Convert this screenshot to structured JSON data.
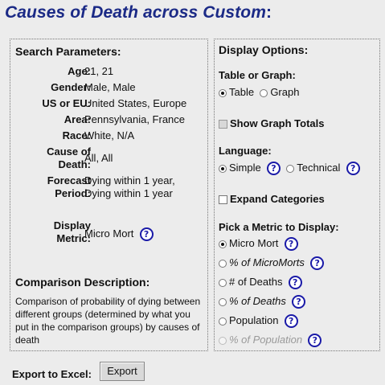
{
  "title": {
    "colored": "Causes of Death across ",
    "custom": "Custom",
    "colon": ":"
  },
  "search": {
    "heading": "Search Parameters:",
    "params": [
      {
        "label": "Age:",
        "value": "21, 21"
      },
      {
        "label": "Gender:",
        "value": "Male, Male"
      },
      {
        "label": "US or EU:",
        "value": "United States, Europe"
      },
      {
        "label": "Area:",
        "value": "Pennsylvania, France"
      },
      {
        "label": "Race:",
        "value": "White, N/A"
      },
      {
        "label_line1": "Cause of",
        "label_line2": "Death:",
        "value": "All, All"
      },
      {
        "label_line1": "Forecast",
        "label_line2": "Period:",
        "value_line1": "Dying within 1 year,",
        "value_line2": "Dying within 1 year"
      },
      {
        "label_line1": "Display",
        "label_line2": "Metric:",
        "value": "Micro Mort"
      }
    ],
    "comparison_heading": "Comparison Description:",
    "comparison_text": "Comparison of probability of dying between different groups (determined by what you put in the comparison groups) by causes of death"
  },
  "display": {
    "heading": "Display Options:",
    "table_or_graph_label": "Table or Graph:",
    "table_label": "Table",
    "graph_label": "Graph",
    "show_graph_totals": "Show Graph Totals",
    "language_label": "Language:",
    "simple_label": "Simple",
    "technical_label": "Technical",
    "expand_categories": "Expand Categories",
    "metric_label": "Pick a Metric to Display:",
    "metrics": [
      {
        "label": "Micro Mort"
      },
      {
        "label": "% of MicroMorts"
      },
      {
        "label": "# of Deaths"
      },
      {
        "label": "% of Deaths"
      },
      {
        "label": "Population"
      },
      {
        "label": "% of Population"
      }
    ],
    "help_glyph": "?"
  },
  "export": {
    "label": "Export to Excel:",
    "button": "Export"
  },
  "colors": {
    "title": "#1b2a86",
    "help": "#1a1aa8",
    "background": "#ececec"
  }
}
